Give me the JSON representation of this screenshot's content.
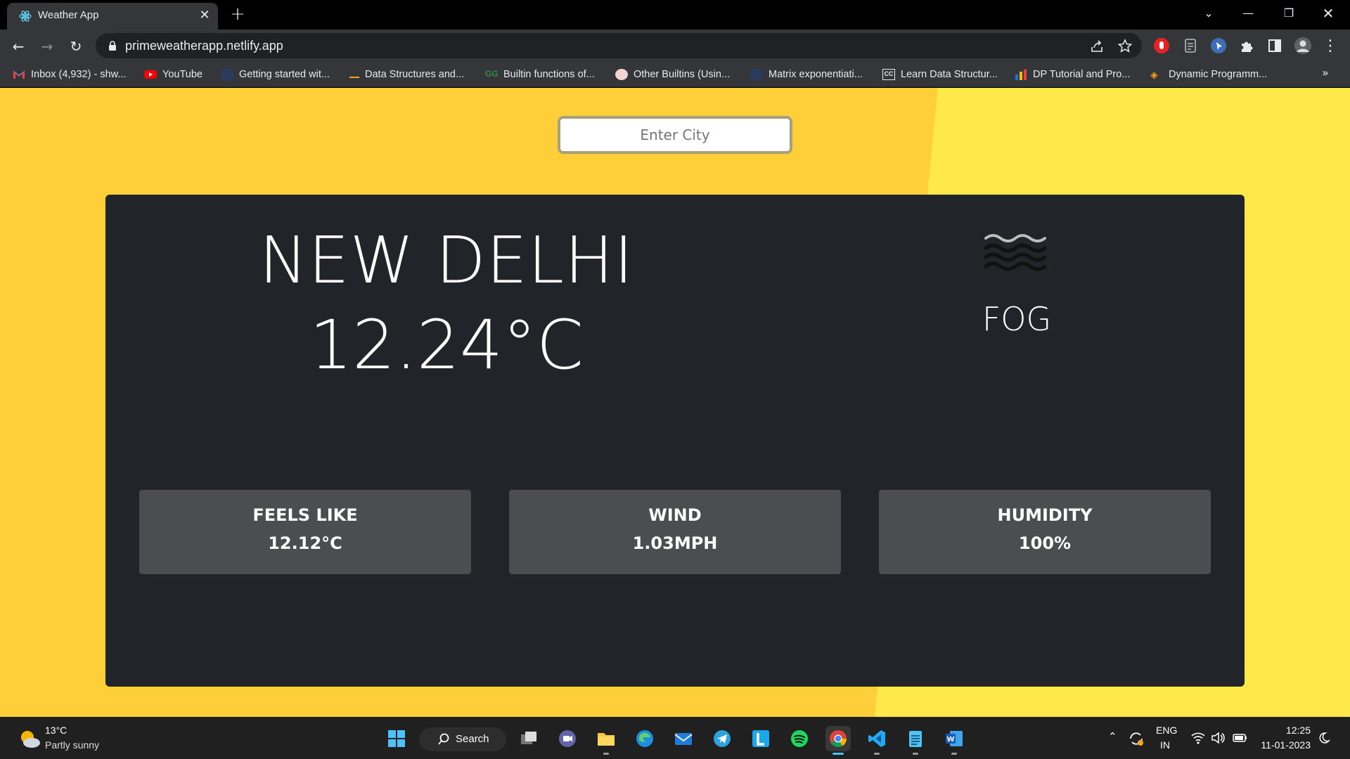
{
  "browser": {
    "tab_title": "Weather App",
    "url": "primeweatherapp.netlify.app",
    "bookmarks": [
      {
        "label": "Inbox (4,932) - shw...",
        "icon": "gmail-icon"
      },
      {
        "label": "YouTube",
        "icon": "youtube-icon"
      },
      {
        "label": "Getting started wit...",
        "icon": "site-icon"
      },
      {
        "label": "Data Structures and...",
        "icon": "site-icon"
      },
      {
        "label": "Builtin functions of...",
        "icon": "site-icon"
      },
      {
        "label": "Other Builtins (Usin...",
        "icon": "site-icon"
      },
      {
        "label": "Matrix exponentiati...",
        "icon": "site-icon"
      },
      {
        "label": "Learn Data Structur...",
        "icon": "cc-icon"
      },
      {
        "label": "DP Tutorial and Pro...",
        "icon": "chart-icon"
      },
      {
        "label": "Dynamic Programm...",
        "icon": "site-icon"
      }
    ]
  },
  "app": {
    "search_placeholder": "Enter City",
    "city": "NEW DELHI",
    "temperature": "12.24°C",
    "condition": "FOG",
    "condition_icon": "fog-icon",
    "stats": [
      {
        "label": "FEELS LIKE",
        "value": "12.12°C"
      },
      {
        "label": "WIND",
        "value": "1.03MPH"
      },
      {
        "label": "HUMIDITY",
        "value": "100%"
      }
    ],
    "colors": {
      "background": "#ffcf3a",
      "card": "#212428",
      "stat_box": "#4b4d50"
    }
  },
  "taskbar": {
    "weather_temp": "13°C",
    "weather_desc": "Partly sunny",
    "search_label": "Search",
    "lang_line1": "ENG",
    "lang_line2": "IN",
    "time": "12:25",
    "date": "11-01-2023"
  }
}
